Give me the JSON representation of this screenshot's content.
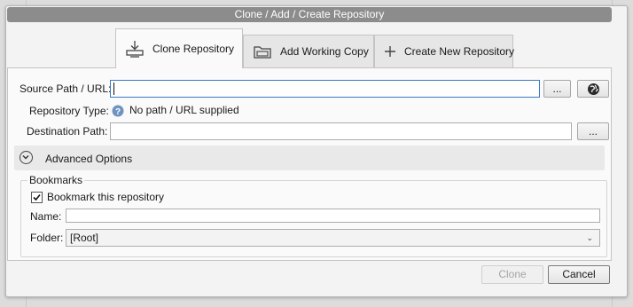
{
  "window": {
    "title": "Clone  / Add / Create Repository"
  },
  "tabs": [
    {
      "label": "Clone Repository",
      "icon": "clone-download-icon",
      "active": true
    },
    {
      "label": "Add Working Copy",
      "icon": "folder-icon",
      "active": false
    },
    {
      "label": "Create New Repository",
      "icon": "plus-icon",
      "active": false
    }
  ],
  "form": {
    "source_label": "Source Path / URL:",
    "source_value": "",
    "browse_label": "...",
    "remote_icon": "globe-icon",
    "repo_type_label": "Repository Type:",
    "repo_type_icon": "help-icon",
    "repo_type_value": "No path / URL supplied",
    "destination_label": "Destination Path:",
    "destination_value": "",
    "destination_browse_label": "..."
  },
  "advanced": {
    "label": "Advanced Options",
    "icon": "chevron-down-icon",
    "expanded": false
  },
  "bookmarks": {
    "group_label": "Bookmarks",
    "checkbox_label": "Bookmark this repository",
    "checked": true,
    "name_label": "Name:",
    "name_value": "",
    "folder_label": "Folder:",
    "folder_value": "[Root]"
  },
  "footer": {
    "clone_label": "Clone",
    "clone_enabled": false,
    "cancel_label": "Cancel"
  },
  "colors": {
    "titlebar": "#8c8c8c",
    "focus_border": "#3a78c8",
    "help_icon": "#6f93c0"
  }
}
